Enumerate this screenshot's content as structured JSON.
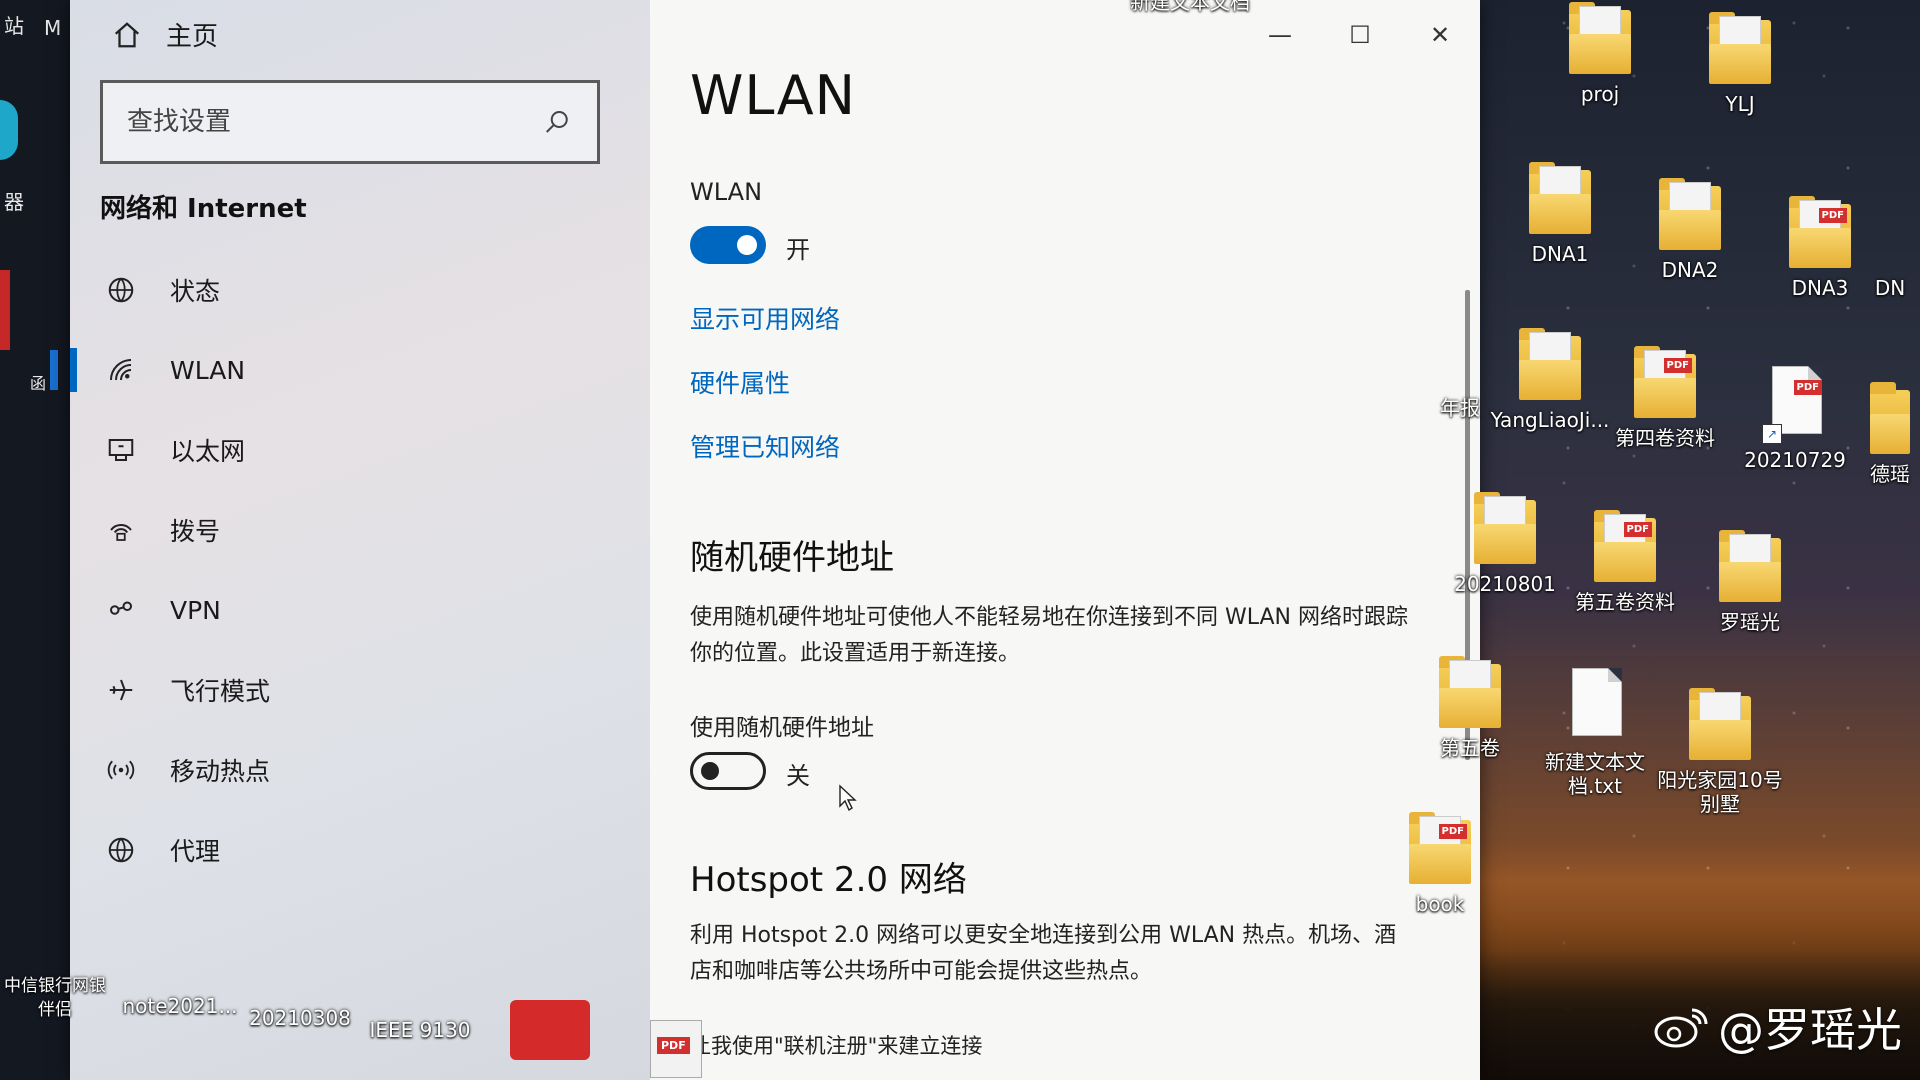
{
  "desktop_left_edge": {
    "top_text": "站",
    "top_text_2": "M",
    "mid_text": "器",
    "lower_text": "函"
  },
  "nav": {
    "home_label": "主页",
    "search_placeholder": "查找设置",
    "section_title": "网络和 Internet",
    "items": [
      {
        "label": "状态",
        "icon": "globe-icon"
      },
      {
        "label": "WLAN",
        "icon": "wifi-icon"
      },
      {
        "label": "以太网",
        "icon": "ethernet-icon"
      },
      {
        "label": "拨号",
        "icon": "dialup-icon"
      },
      {
        "label": "VPN",
        "icon": "vpn-icon"
      },
      {
        "label": "飞行模式",
        "icon": "airplane-icon"
      },
      {
        "label": "移动热点",
        "icon": "hotspot-icon"
      },
      {
        "label": "代理",
        "icon": "proxy-globe-icon"
      }
    ],
    "active_index": 1
  },
  "window_controls": {
    "minimize": "—",
    "maximize": "☐",
    "close": "✕"
  },
  "content": {
    "title": "WLAN",
    "wlan_label": "WLAN",
    "wlan_toggle_state": "开",
    "wlan_on": true,
    "links": [
      "显示可用网络",
      "硬件属性",
      "管理已知网络"
    ],
    "random_hw": {
      "heading": "随机硬件地址",
      "description": "使用随机硬件地址可使他人不能轻易地在你连接到不同 WLAN 网络时跟踪你的位置。此设置适用于新连接。",
      "toggle_label": "使用随机硬件地址",
      "toggle_state": "关",
      "on": false
    },
    "hotspot": {
      "heading": "Hotspot 2.0 网络",
      "description": "利用 Hotspot 2.0 网络可以更安全地连接到公用 WLAN 热点。机场、酒店和咖啡店等公共场所中可能会提供这些热点。",
      "cut_line": "让我使用\"联机注册\"来建立连接"
    }
  },
  "desktop_icons": [
    {
      "label": "新建文本文档",
      "type": "doc"
    },
    {
      "label": "proj",
      "type": "folder"
    },
    {
      "label": "YLJ",
      "type": "folder"
    },
    {
      "label": "DNA1",
      "type": "folder"
    },
    {
      "label": "DNA2",
      "type": "folder"
    },
    {
      "label": "DNA3",
      "type": "folder-pdf"
    },
    {
      "label": "DN",
      "type": "folder"
    },
    {
      "label": "年报",
      "type": "text"
    },
    {
      "label": "YangLiaoJi...",
      "type": "folder"
    },
    {
      "label": "第四卷资料",
      "type": "folder-pdf"
    },
    {
      "label": "20210729",
      "type": "pdf-shortcut"
    },
    {
      "label": "德瑶",
      "type": "folder"
    },
    {
      "label": "20210801",
      "type": "folder"
    },
    {
      "label": "第五卷资料",
      "type": "folder-pdf"
    },
    {
      "label": "罗瑶光",
      "type": "folder"
    },
    {
      "label": "第五卷",
      "type": "folder"
    },
    {
      "label": "新建文本文档.txt",
      "type": "doc"
    },
    {
      "label": "阳光家园10号别墅",
      "type": "folder"
    },
    {
      "label": "book",
      "type": "folder-pdf"
    }
  ],
  "bottom_icons": [
    {
      "label": "中信银行网银伴侣",
      "type": "shortcut"
    },
    {
      "label": "note2021...",
      "type": "folder"
    },
    {
      "label": "20210308",
      "type": "folder"
    },
    {
      "label": "IEEE 9130",
      "type": "folder"
    },
    {
      "label": "",
      "type": "app-shortcut"
    },
    {
      "label": "",
      "type": "pdf"
    }
  ],
  "watermark": {
    "text": "@罗瑶光",
    "icon": "weibo-icon"
  },
  "colors": {
    "accent": "#0067c0",
    "nav_bg": "#dde1e7",
    "content_bg": "#f7f7f5"
  }
}
